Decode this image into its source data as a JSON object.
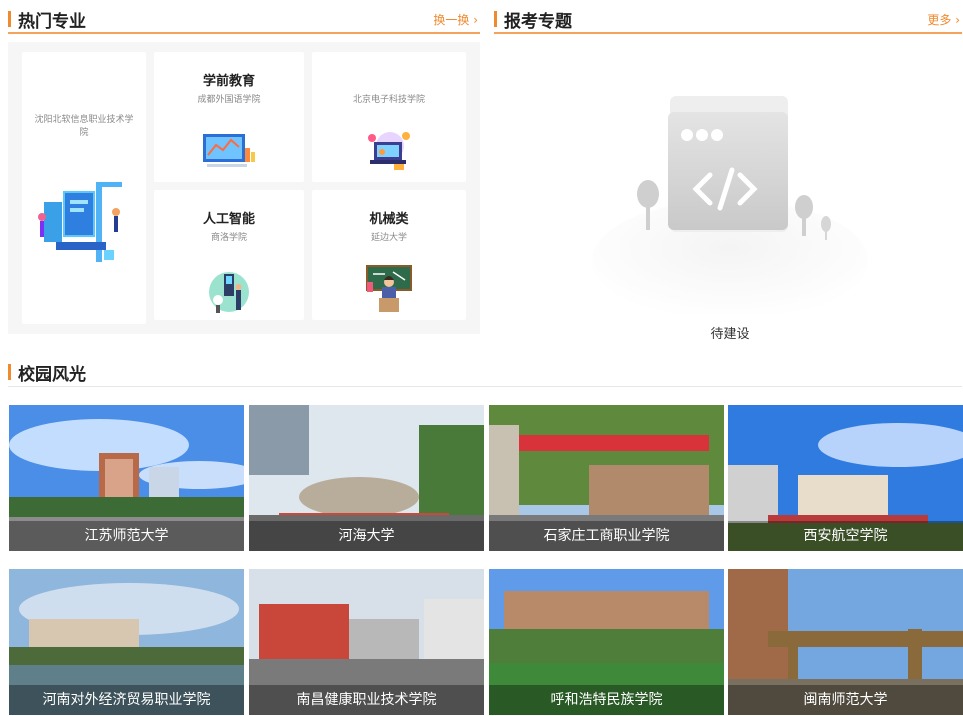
{
  "hot_majors": {
    "title": "热门专业",
    "action": "换一换",
    "action_icon": "chevron-right-icon",
    "featured": {
      "school": "沈阳北软信息职业技术学院"
    },
    "cards": [
      {
        "major": "学前教育",
        "school": "成都外国语学院"
      },
      {
        "major": "",
        "school": "北京电子科技学院"
      },
      {
        "major": "人工智能",
        "school": "商洛学院"
      },
      {
        "major": "机械类",
        "school": "延边大学"
      }
    ]
  },
  "topics": {
    "title": "报考专题",
    "action": "更多",
    "action_icon": "chevron-right-icon",
    "empty_text": "待建设"
  },
  "campus": {
    "title": "校园风光",
    "photos": [
      {
        "name": "江苏师范大学"
      },
      {
        "name": "河海大学"
      },
      {
        "name": "石家庄工商职业学院"
      },
      {
        "name": "西安航空学院"
      },
      {
        "name": "河南对外经济贸易职业学院"
      },
      {
        "name": "南昌健康职业技术学院"
      },
      {
        "name": "呼和浩特民族学院"
      },
      {
        "name": "闽南师范大学"
      }
    ]
  },
  "colors": {
    "accent": "#f08a2e",
    "accent_line": "#f5a25a",
    "panel_bg": "#f6f6f6"
  }
}
